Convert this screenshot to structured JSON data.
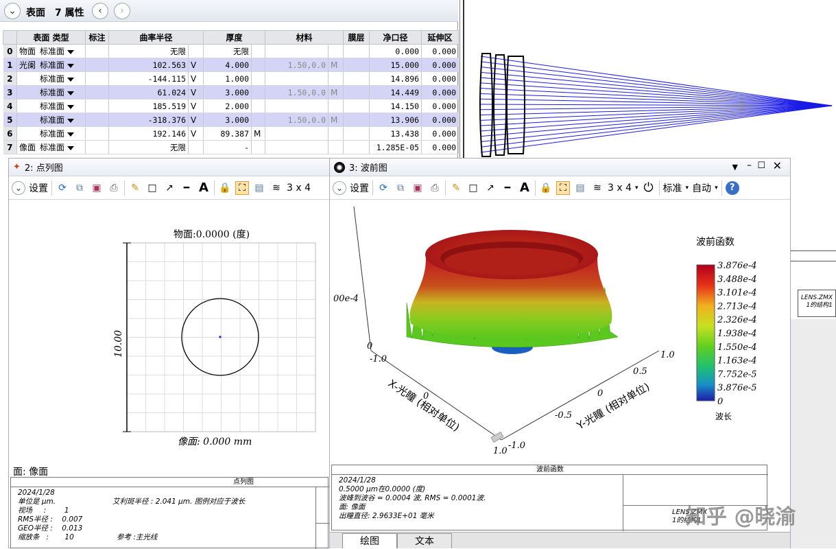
{
  "lens_editor": {
    "surface_label": "表面",
    "props_label": "7 属性",
    "columns": [
      "表面 类型",
      "标注",
      "曲率半径",
      "厚度",
      "材料",
      "膜层",
      "净口径",
      "延伸区"
    ],
    "rows": [
      {
        "idx": "0",
        "name": "物面",
        "type": "标准面",
        "radius": "无限",
        "rflag": "",
        "thick": "无限",
        "tflag": "",
        "material": "",
        "mflag": "",
        "clear": "0.000",
        "ext": "0.000"
      },
      {
        "idx": "1",
        "name": "光阑",
        "type": "标准面",
        "radius": "102.563",
        "rflag": "V",
        "thick": "4.000",
        "tflag": "",
        "material": "1.50,0.0",
        "mflag": "M",
        "clear": "15.000",
        "ext": "0.000"
      },
      {
        "idx": "2",
        "name": "",
        "type": "标准面",
        "radius": "-144.115",
        "rflag": "V",
        "thick": "1.000",
        "tflag": "",
        "material": "",
        "mflag": "",
        "clear": "14.896",
        "ext": "0.000"
      },
      {
        "idx": "3",
        "name": "",
        "type": "标准面",
        "radius": "61.024",
        "rflag": "V",
        "thick": "3.000",
        "tflag": "",
        "material": "1.50,0.0",
        "mflag": "M",
        "clear": "14.449",
        "ext": "0.000"
      },
      {
        "idx": "4",
        "name": "",
        "type": "标准面",
        "radius": "185.519",
        "rflag": "V",
        "thick": "2.000",
        "tflag": "",
        "material": "",
        "mflag": "",
        "clear": "14.150",
        "ext": "0.000"
      },
      {
        "idx": "5",
        "name": "",
        "type": "标准面",
        "radius": "-318.376",
        "rflag": "V",
        "thick": "3.000",
        "tflag": "",
        "material": "1.50,0.0",
        "mflag": "M",
        "clear": "13.906",
        "ext": "0.000"
      },
      {
        "idx": "6",
        "name": "",
        "type": "标准面",
        "radius": "192.146",
        "rflag": "V",
        "thick": "89.387",
        "tflag": "M",
        "material": "",
        "mflag": "",
        "clear": "13.438",
        "ext": "0.000"
      },
      {
        "idx": "7",
        "name": "像面",
        "type": "标准面",
        "radius": "无限",
        "rflag": "",
        "thick": "-",
        "tflag": "",
        "material": "",
        "mflag": "",
        "clear": "1.285E-05",
        "ext": "0.000"
      }
    ]
  },
  "layout_view": {
    "right_labels": [
      "LENS.ZMX",
      "1的结构1"
    ]
  },
  "spot": {
    "title": "2: 点列图",
    "settings_label": "设置",
    "grid_label": "3 x 4",
    "obj_label": "物面:0.0000 (度)",
    "img_label": "像面: 0.000 mm",
    "scale_label": "10.00",
    "surface_label": "面: 像面",
    "info_header": "点列图",
    "info_lines": [
      "2024/1/28",
      "单位是 µm.",
      "视场     :        1",
      "RMS半径 :    0.007",
      "GEO半径 :    0.013",
      "缩放条   :       10"
    ],
    "airy": "艾利斑半径 : 2.041 µm. 图例对应于波长",
    "ref": "参考   :主光线"
  },
  "wavefront": {
    "title": "3: 波前图",
    "settings_label": "设置",
    "grid_label": "3 x 4",
    "std_label": "标准",
    "auto_label": "自动",
    "legend_title": "波前函数",
    "legend_unit": "波长",
    "legend_values": [
      "3.876e-4",
      "3.488e-4",
      "3.101e-4",
      "2.713e-4",
      "2.326e-4",
      "1.938e-4",
      "1.550e-4",
      "1.163e-4",
      "7.752e-5",
      "3.876e-5",
      "0"
    ],
    "axis_z_label": "00e-4",
    "axis_z_zero": "0",
    "x_axis_label": "X-光瞳 (相对单位)",
    "y_axis_label": "Y-光瞳 (相对单位)",
    "x_ticks": [
      "-1.0",
      "0",
      "1.0"
    ],
    "y_ticks": [
      "-1.0",
      "-0.5",
      "0",
      "0.5",
      "1.0"
    ],
    "info_header": "波前函数",
    "info_lines": [
      "2024/1/28",
      "0.5000 µm在0.0000 (度)",
      "波峰到波谷 = 0.0004 波, RMS = 0.0001波.",
      "面: 像面",
      "出瞳直径: 2.9633E+01 毫米"
    ],
    "info_right": [
      "LENS.ZMX",
      "1的结构1"
    ],
    "tab_plot": "绘图",
    "tab_text": "文本",
    "colors": {
      "max": "#b0001a",
      "mid": "#7fd000",
      "min": "#1c1caa"
    }
  },
  "watermark": "知乎 @晓渝"
}
